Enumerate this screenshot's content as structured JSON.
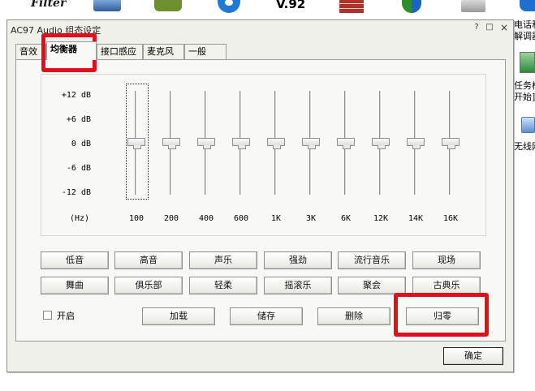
{
  "desktop": {
    "top_labels": {
      "filter_logo": "Filter",
      "version": "V.92"
    },
    "icons": [
      "filter-logo",
      "monitor-icon",
      "nvidia-icon",
      "q-icon",
      "brick-wall-icon",
      "security-shield-icon",
      "printer-icon",
      "network-icon"
    ],
    "side_labels": [
      "电话和",
      "解调器",
      "任务栏",
      "开始]",
      "无线网"
    ]
  },
  "dialog": {
    "title": "AC97 Audio 组态设定",
    "title_buttons": {
      "help": "?",
      "minimize": "□",
      "close": "×"
    },
    "tabs": [
      {
        "label": "音效"
      },
      {
        "label": "均衡器"
      },
      {
        "label": "接口感应"
      },
      {
        "label": "麦克风"
      },
      {
        "label": "一般"
      }
    ],
    "active_tab": "均衡器",
    "equalizer": {
      "db_labels": [
        "+12 dB",
        "+6 dB",
        "0 dB",
        "-6 dB",
        "-12 dB"
      ],
      "hz_label": "(Hz)",
      "bands": [
        {
          "freq": "100",
          "level_db": 0
        },
        {
          "freq": "200",
          "level_db": 0
        },
        {
          "freq": "400",
          "level_db": 0
        },
        {
          "freq": "600",
          "level_db": 0
        },
        {
          "freq": "1K",
          "level_db": 0
        },
        {
          "freq": "3K",
          "level_db": 0
        },
        {
          "freq": "6K",
          "level_db": 0
        },
        {
          "freq": "12K",
          "level_db": 0
        },
        {
          "freq": "14K",
          "level_db": 0
        },
        {
          "freq": "16K",
          "level_db": 0
        }
      ]
    },
    "presets_row1": [
      "低音",
      "高音",
      "声乐",
      "强劲",
      "流行音乐",
      "现场"
    ],
    "presets_row2": [
      "舞曲",
      "俱乐部",
      "轻柔",
      "摇滚乐",
      "聚会",
      "古典乐"
    ],
    "enable_checkbox": {
      "label": "开启",
      "checked": false
    },
    "actions": {
      "load": "加载",
      "save": "储存",
      "delete": "删除",
      "reset": "归零"
    },
    "ok": "确定"
  },
  "colors": {
    "annotation_red": "#e30e1c",
    "dialog_bg": "#f0f0ea"
  }
}
